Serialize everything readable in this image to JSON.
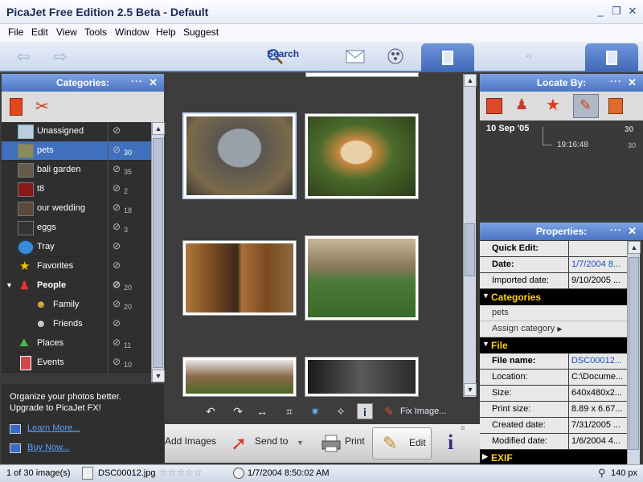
{
  "window": {
    "title": "PicaJet Free Edition 2.5 Beta - Default",
    "min": "_",
    "restore": "❐",
    "close": "✕"
  },
  "menu": [
    "File",
    "Edit",
    "View",
    "Tools",
    "Window",
    "Help",
    "Suggest"
  ],
  "toolbar": {
    "search_label": "Search"
  },
  "categories_panel": {
    "title": "Categories:",
    "items": [
      {
        "label": "Unassigned",
        "count": ""
      },
      {
        "label": "pets",
        "count": "30"
      },
      {
        "label": "bali garden",
        "count": "35"
      },
      {
        "label": "t8",
        "count": "2"
      },
      {
        "label": "our wedding",
        "count": "18"
      },
      {
        "label": "eggs",
        "count": "3"
      },
      {
        "label": "Tray",
        "count": ""
      },
      {
        "label": "Favorites",
        "count": ""
      },
      {
        "label": "People",
        "count": "20"
      },
      {
        "label": "Family",
        "count": "20"
      },
      {
        "label": "Friends",
        "count": ""
      },
      {
        "label": "Places",
        "count": "11"
      },
      {
        "label": "Events",
        "count": "10"
      }
    ]
  },
  "promo": {
    "line1": "Organize your photos better.",
    "line2": "Upgrade to PicaJet FX!",
    "learn_more": "Learn More...",
    "buy_now": "Buy Now..."
  },
  "image_toolbar": {
    "fix_image": "Fix Image..."
  },
  "bottom_actions": {
    "add_images": "Add Images",
    "send_to": "Send to",
    "print": "Print",
    "edit": "Edit"
  },
  "locate_panel": {
    "title": "Locate By:",
    "date": "10 Sep  '05",
    "date_count": "30",
    "time": "19:16:48",
    "time_count": "30"
  },
  "properties_panel": {
    "title": "Properties:",
    "quick_edit": "Quick Edit:",
    "date_label": "Date:",
    "date_value": "1/7/2004 8...",
    "imported_label": "Imported date:",
    "imported_value": "9/10/2005 ...",
    "categories_section": "Categories",
    "category_value": "pets",
    "assign_category": "Assign category",
    "file_section": "File",
    "file_name_label": "File name:",
    "file_name_value": "DSC00012...",
    "location_label": "Location:",
    "location_value": "C:\\Docume...",
    "size_label": "Size:",
    "size_value": "640x480x2...",
    "print_size_label": "Print size:",
    "print_size_value": "8.89 x 6.67...",
    "created_label": "Created date:",
    "created_value": "7/31/2005 ...",
    "modified_label": "Modified date:",
    "modified_value": "1/6/2004 4...",
    "exif_section": "EXIF"
  },
  "statusbar": {
    "images": "1 of 30 image(s)",
    "filename": "DSC00012.jpg",
    "rating_stars": "☆☆☆☆☆",
    "datetime": "1/7/2004 8:50:02 AM",
    "zoom": "140 px"
  },
  "colors": {
    "accent": "#4a75c4",
    "selected": "#3f6fbd",
    "section_text": "#ffd400"
  }
}
